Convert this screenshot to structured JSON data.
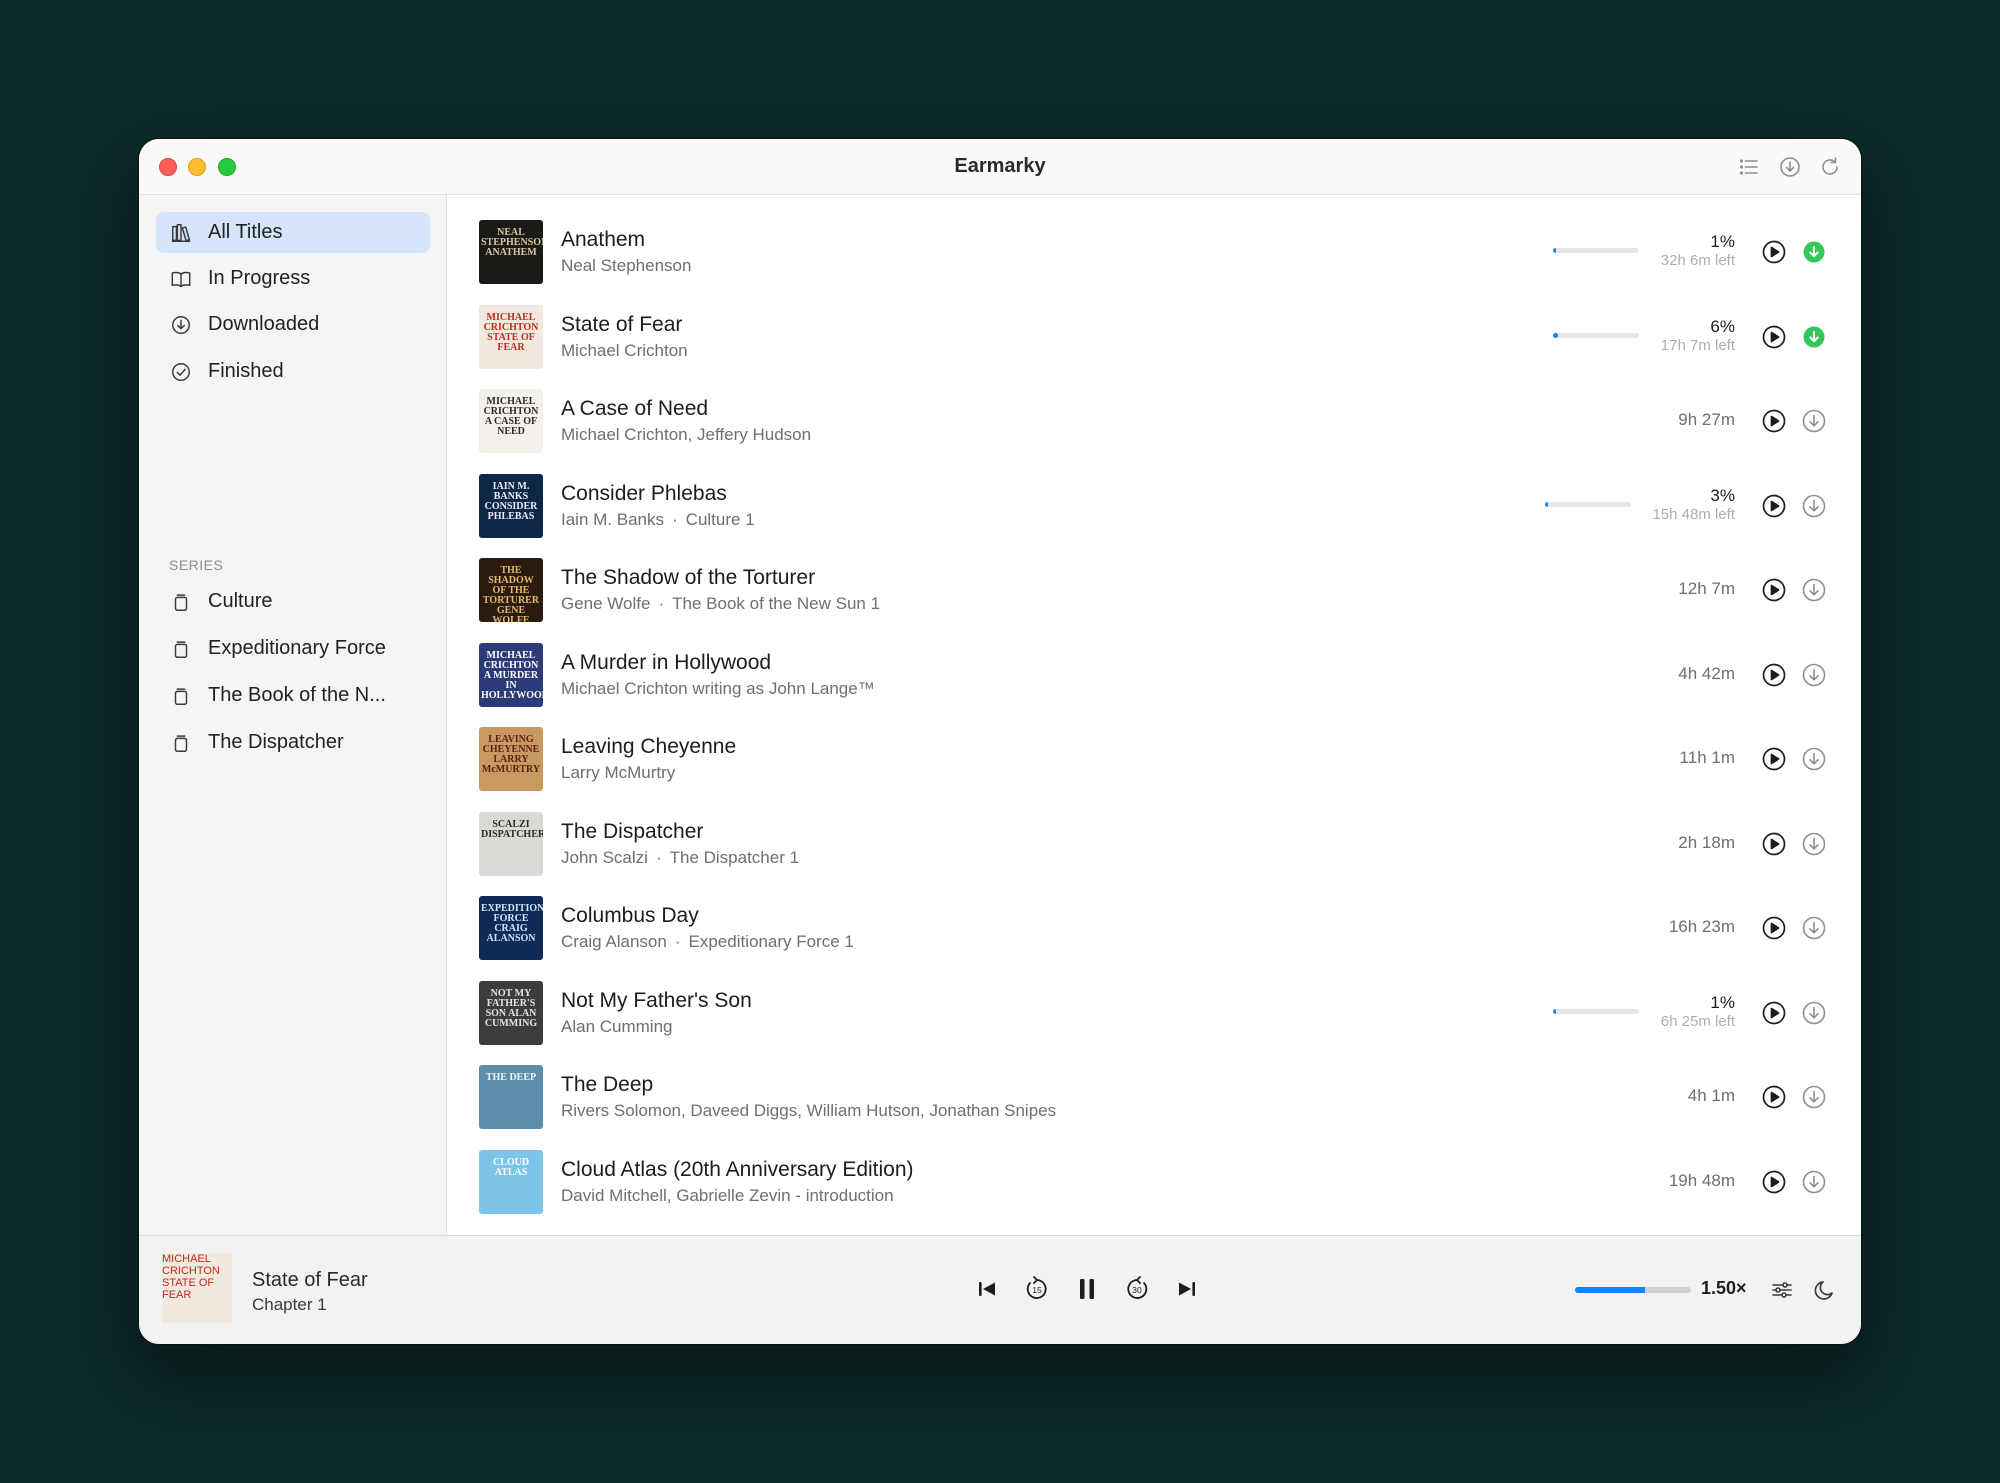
{
  "window": {
    "title": "Earmarky"
  },
  "toolbar": {
    "icons": [
      "list-icon",
      "download-icon",
      "refresh-icon"
    ]
  },
  "sidebar": {
    "items": [
      {
        "label": "All Titles",
        "icon": "library-icon",
        "active": true
      },
      {
        "label": "In Progress",
        "icon": "book-open-icon"
      },
      {
        "label": "Downloaded",
        "icon": "download-circle-icon"
      },
      {
        "label": "Finished",
        "icon": "check-circle-icon"
      }
    ],
    "series_header": "SERIES",
    "series": [
      {
        "label": "Culture",
        "icon": "stack-icon"
      },
      {
        "label": "Expeditionary Force",
        "icon": "stack-icon"
      },
      {
        "label": "The Book of the N...",
        "icon": "stack-icon"
      },
      {
        "label": "The Dispatcher",
        "icon": "stack-icon"
      }
    ]
  },
  "titles": [
    {
      "title": "Anathem",
      "author": "Neal Stephenson",
      "series": "",
      "progress_label": "1%",
      "progress": 0.01,
      "time_left": "32h 6m left",
      "duration": "",
      "downloaded": true,
      "cover": {
        "bg": "#1b1a17",
        "fg": "#d9c9a0",
        "text": "NEAL STEPHENSON ANATHEM"
      }
    },
    {
      "title": "State of Fear",
      "author": "Michael Crichton",
      "series": "",
      "progress_label": "6%",
      "progress": 0.06,
      "time_left": "17h 7m left",
      "duration": "",
      "downloaded": true,
      "cover": {
        "bg": "#efe9df",
        "fg": "#c8281e",
        "text": "MICHAEL CRICHTON STATE OF FEAR"
      }
    },
    {
      "title": "A Case of Need",
      "author": "Michael Crichton, Jeffery Hudson",
      "series": "",
      "progress_label": "",
      "progress": null,
      "time_left": "",
      "duration": "9h 27m",
      "downloaded": false,
      "cover": {
        "bg": "#f4f1ec",
        "fg": "#2a2a2a",
        "text": "MICHAEL CRICHTON A CASE OF NEED"
      }
    },
    {
      "title": "Consider Phlebas",
      "author": "Iain M. Banks",
      "series": "Culture 1",
      "progress_label": "3%",
      "progress": 0.03,
      "time_left": "15h 48m left",
      "duration": "",
      "downloaded": false,
      "cover": {
        "bg": "#0e2746",
        "fg": "#e8eef8",
        "text": "IAIN M. BANKS CONSIDER PHLEBAS"
      }
    },
    {
      "title": "The Shadow of the Torturer",
      "author": "Gene Wolfe",
      "series": "The Book of the New Sun 1",
      "progress_label": "",
      "progress": null,
      "time_left": "",
      "duration": "12h 7m",
      "downloaded": false,
      "cover": {
        "bg": "#2a1a10",
        "fg": "#e6b96a",
        "text": "THE SHADOW OF THE TORTURER GENE WOLFE"
      }
    },
    {
      "title": "A Murder in Hollywood",
      "author": "Michael Crichton writing as John Lange™",
      "series": "",
      "progress_label": "",
      "progress": null,
      "time_left": "",
      "duration": "4h 42m",
      "downloaded": false,
      "cover": {
        "bg": "#2c3a78",
        "fg": "#ffffff",
        "text": "MICHAEL CRICHTON A MURDER IN HOLLYWOOD"
      }
    },
    {
      "title": "Leaving Cheyenne",
      "author": "Larry McMurtry",
      "series": "",
      "progress_label": "",
      "progress": null,
      "time_left": "",
      "duration": "11h 1m",
      "downloaded": false,
      "cover": {
        "bg": "#c89a62",
        "fg": "#5a1e10",
        "text": "LEAVING CHEYENNE LARRY McMURTRY"
      }
    },
    {
      "title": "The Dispatcher",
      "author": "John Scalzi",
      "series": "The Dispatcher 1",
      "progress_label": "",
      "progress": null,
      "time_left": "",
      "duration": "2h 18m",
      "downloaded": false,
      "cover": {
        "bg": "#d9d9d6",
        "fg": "#2a2a2a",
        "text": "SCALZI DISPATCHER"
      }
    },
    {
      "title": "Columbus Day",
      "author": "Craig Alanson",
      "series": "Expeditionary Force 1",
      "progress_label": "",
      "progress": null,
      "time_left": "",
      "duration": "16h 23m",
      "downloaded": false,
      "cover": {
        "bg": "#0f2b55",
        "fg": "#cfe3ff",
        "text": "EXPEDITIONARY FORCE CRAIG ALANSON"
      }
    },
    {
      "title": "Not My Father's Son",
      "author": "Alan Cumming",
      "series": "",
      "progress_label": "1%",
      "progress": 0.01,
      "time_left": "6h 25m left",
      "duration": "",
      "downloaded": false,
      "cover": {
        "bg": "#3c3c3c",
        "fg": "#e5e5e5",
        "text": "NOT MY FATHER'S SON ALAN CUMMING"
      }
    },
    {
      "title": "The Deep",
      "author": "Rivers Solomon, Daveed Diggs, William Hutson, Jonathan Snipes",
      "series": "",
      "progress_label": "",
      "progress": null,
      "time_left": "",
      "duration": "4h 1m",
      "downloaded": false,
      "cover": {
        "bg": "#5b8ea8",
        "fg": "#f0f6fa",
        "text": "THE DEEP"
      }
    },
    {
      "title": "Cloud Atlas (20th Anniversary Edition)",
      "author": "David Mitchell, Gabrielle Zevin - introduction",
      "series": "",
      "progress_label": "",
      "progress": null,
      "time_left": "",
      "duration": "19h 48m",
      "downloaded": false,
      "cover": {
        "bg": "#7cc5e6",
        "fg": "#ffffff",
        "text": "CLOUD ATLAS"
      }
    }
  ],
  "player": {
    "title": "State of Fear",
    "chapter": "Chapter 1",
    "speed_label": "1.50×",
    "speed_level": 0.6,
    "controls": [
      "previous-chapter-icon",
      "skip-back-15-icon",
      "pause-icon",
      "skip-forward-30-icon",
      "next-chapter-icon"
    ],
    "cover": {
      "bg": "#efe9df",
      "fg": "#c8281e",
      "text": "MICHAEL CRICHTON STATE OF FEAR"
    }
  },
  "colors": {
    "accent": "#0a84ff",
    "downloaded": "#34c759",
    "selection": "#d4e5fa"
  }
}
